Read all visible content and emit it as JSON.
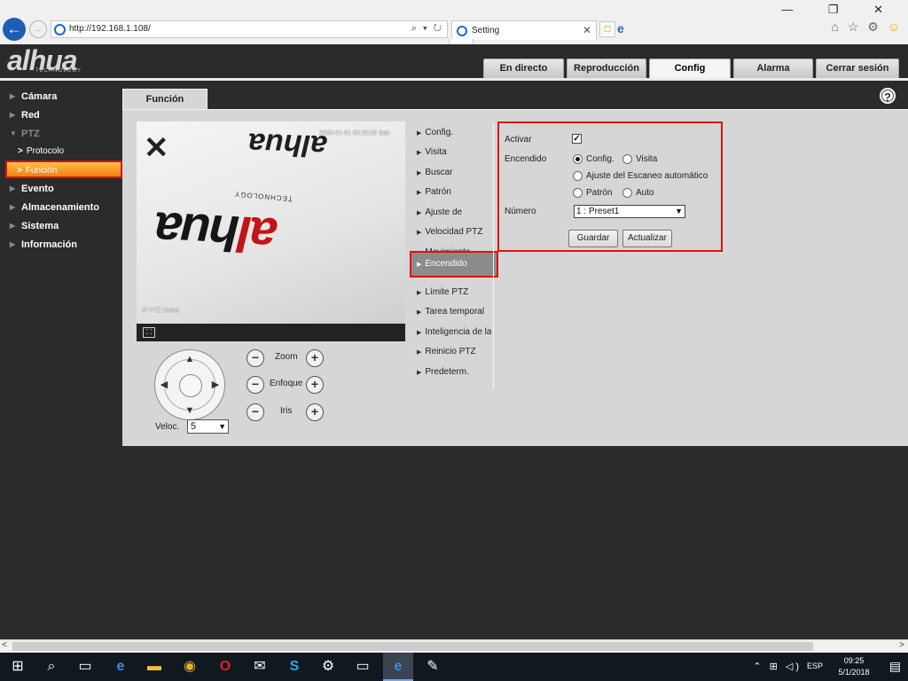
{
  "browser": {
    "url": "http://192.168.1.108/",
    "address_tools": "⌕ ▾ ↻",
    "tab_title": "Setting",
    "tab_close": "✕",
    "new_tab_glyph": "◻",
    "ie_logo_glyph": "e",
    "tab_dropdown_glyph": "⌄",
    "window_controls": "— ❐ ✕",
    "back_glyph": "←",
    "forward_glyph": "→",
    "tools_glyphs": "⌂ ☆ ⚙",
    "smiley_glyph": "☺"
  },
  "app": {
    "logo": "alhua",
    "logo_sub": "TECHNOLOGY",
    "top_tabs": [
      {
        "label": "En directo",
        "active": false
      },
      {
        "label": "Reproducción",
        "active": false
      },
      {
        "label": "Config",
        "active": true
      },
      {
        "label": "Alarma",
        "active": false
      },
      {
        "label": "Cerrar sesión",
        "active": false
      }
    ]
  },
  "sidebar": {
    "items": [
      {
        "label": "Cámara"
      },
      {
        "label": "Red"
      },
      {
        "label": "PTZ"
      },
      {
        "label": "Evento"
      },
      {
        "label": "Almacenamiento"
      },
      {
        "label": "Sistema"
      },
      {
        "label": "Información"
      }
    ],
    "sub_items": [
      {
        "label": "Protocolo"
      },
      {
        "label": "Función"
      }
    ],
    "tri_glyph": "▶",
    "open_glyph": "▼",
    "chev_glyph": ">"
  },
  "content": {
    "tab_title": "Función",
    "help_glyph": "?"
  },
  "video": {
    "osd_time": "2000-01-01 00:20:20 Sab",
    "osd_name": "IP PTZ Dome",
    "brand_top": "alhua",
    "brand_main_a": "al",
    "brand_main_b": "hua",
    "tech": "TECHNOLOGY",
    "fullscreen_glyph": "⛶"
  },
  "ptz": {
    "zoom_label": "Zoom",
    "focus_label": "Enfoque",
    "iris_label": "Iris",
    "minus_glyph": "−",
    "plus_glyph": "+",
    "up_glyph": "▲",
    "down_glyph": "▼",
    "left_glyph": "◀",
    "right_glyph": "▶",
    "speed_label": "Veloc.",
    "speed_value": "5",
    "select_arrow": "▼"
  },
  "menu": {
    "items": [
      {
        "label": "Config."
      },
      {
        "label": "Visita"
      },
      {
        "label": "Buscar"
      },
      {
        "label": "Patrón"
      },
      {
        "label": "Ajuste de"
      },
      {
        "label": "Velocidad PTZ"
      },
      {
        "label": "Movimiento"
      },
      {
        "label": "Encendido"
      },
      {
        "label": "Límite PTZ"
      },
      {
        "label": "Tarea temporal"
      },
      {
        "label": "Inteligencia de la"
      },
      {
        "label": "Reinicio PTZ"
      },
      {
        "label": "Predeterm."
      }
    ],
    "tri_glyph": "▶"
  },
  "form": {
    "enable_label": "Activar",
    "enable_checked": true,
    "check_glyph": "✓",
    "power_label": "Encendido",
    "options": [
      {
        "label": "Config.",
        "selected": true
      },
      {
        "label": "Visita",
        "selected": false
      },
      {
        "label": "Ajuste del Escaneo automático",
        "selected": false
      },
      {
        "label": "Patrón",
        "selected": false
      },
      {
        "label": "Auto",
        "selected": false
      }
    ],
    "number_label": "Número",
    "number_value": "1 : Preset1",
    "save_button": "Guardar",
    "refresh_button": "Actualizar"
  },
  "taskbar": {
    "tray_icons": "⌃ ⊞ ◁)",
    "lang": "ESP",
    "time": "09:25",
    "date": "5/1/2018",
    "start_glyph": "⊞",
    "search_glyph": "⌕",
    "taskview_glyph": "▭",
    "edge_glyph": "e",
    "folder_glyph": "▬",
    "chrome_glyph": "◉",
    "opera_glyph": "O",
    "mail_glyph": "✉",
    "skype_glyph": "S",
    "settings_glyph": "⚙",
    "cmd_glyph": "▭",
    "ie_glyph": "e",
    "paint_glyph": "✎",
    "notification_glyph": "▤"
  },
  "scroll": {
    "left_glyph": "<",
    "right_glyph": ">"
  }
}
